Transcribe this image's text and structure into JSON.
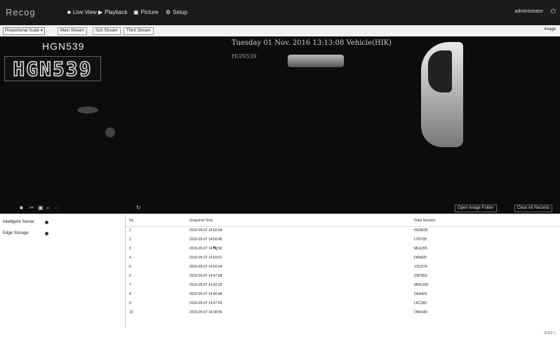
{
  "app": {
    "logo": "Recog",
    "user": "administrator",
    "logout_icon": "logout-icon"
  },
  "nav": [
    {
      "label": "Live View",
      "icon": "eye-icon"
    },
    {
      "label": "Playback",
      "icon": "film-icon"
    },
    {
      "label": "Picture",
      "icon": "image-icon"
    },
    {
      "label": "Setup",
      "icon": "gear-icon"
    }
  ],
  "toolbar": {
    "ratio_select": "Proportional Scale",
    "main_stream": "Main Stream",
    "sub_stream": "Sub Stream",
    "third_stream": "Third Stream",
    "right_label": "Image"
  },
  "video": {
    "plate_text": "HGN539",
    "plate_image_text": "HGN539",
    "overlay_line1": "Tuesday 01 Nov. 2016 13:13:08 Vehicle(HIK)",
    "overlay_line2": "HGN539"
  },
  "controls": {
    "zoom_icon": "zoom-icon",
    "open_folder": "Open Image Folder",
    "clear_records": "Clear All Records"
  },
  "left_panel": {
    "items": [
      {
        "label": "Intelligent Server"
      },
      {
        "label": "Edge Storage"
      }
    ]
  },
  "table": {
    "headers": [
      "No.",
      "Snapshot Time",
      "Plate Number"
    ],
    "rows": [
      [
        "1",
        "2016-05-07 14:50:58",
        "HGN539"
      ],
      [
        "2",
        "2016-05-07 14:50:48",
        "LYD728"
      ],
      [
        "3",
        "2016-05-07 14:50:50",
        "MLE155"
      ],
      [
        "4",
        "2016-05-07 14:50:41",
        "FAN625"
      ],
      [
        "5",
        "2016-05-07 14:50:34",
        "VSC674"
      ],
      [
        "6",
        "2016-05-07 14:47:59",
        "DNT859"
      ],
      [
        "7",
        "2016-05-07 14:42:29",
        "MNG159"
      ],
      [
        "8",
        "2016-05-07 14:40:48",
        "DEA425"
      ],
      [
        "9",
        "2016-05-07 14:47:03",
        "LKC360"
      ],
      [
        "10",
        "2016-05-07 14:38:56",
        "ONF443"
      ]
    ]
  },
  "footer": {
    "note": "STEP 1"
  }
}
